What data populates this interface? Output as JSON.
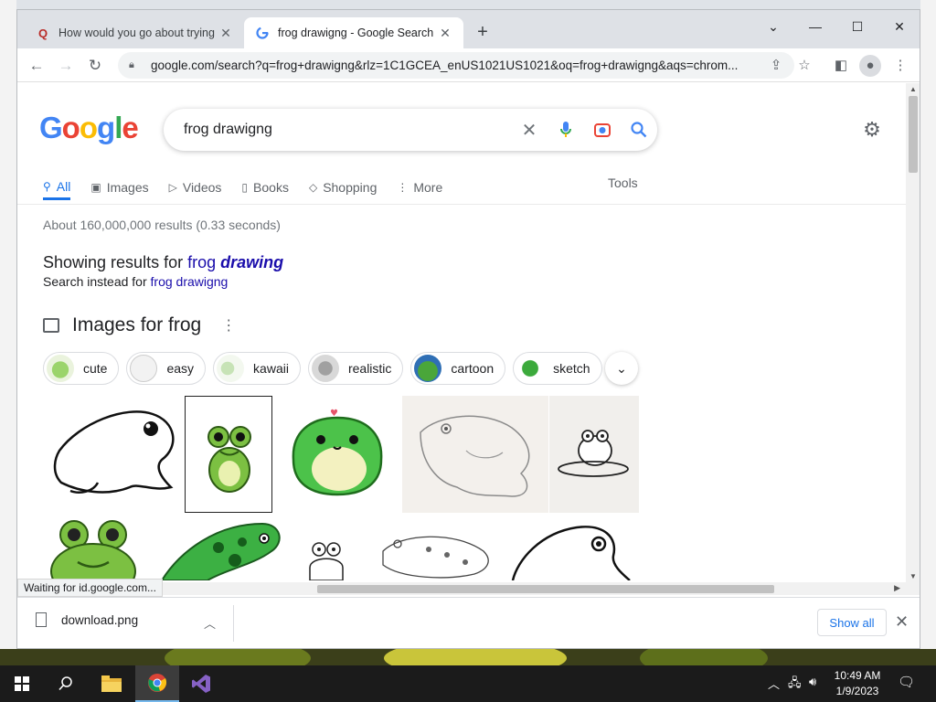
{
  "browser": {
    "tabs": [
      {
        "title": "How would you go about trying",
        "favicon": "quora-icon",
        "active": false
      },
      {
        "title": "frog drawigng - Google Search",
        "favicon": "google-icon",
        "active": true
      }
    ],
    "url": "google.com/search?q=frog+drawigng&rlz=1C1GCEA_enUS1021US1021&oq=frog+drawigng&aqs=chrom..."
  },
  "search": {
    "logo": "Google",
    "query": "frog drawigng"
  },
  "nav": {
    "tabs": [
      {
        "label": "All",
        "icon": "search-icon",
        "active": true
      },
      {
        "label": "Images",
        "icon": "image-icon"
      },
      {
        "label": "Videos",
        "icon": "video-icon"
      },
      {
        "label": "Books",
        "icon": "book-icon"
      },
      {
        "label": "Shopping",
        "icon": "tag-icon"
      },
      {
        "label": "More",
        "icon": "dots-icon"
      }
    ],
    "tools": "Tools"
  },
  "results": {
    "stats": "About 160,000,000 results (0.33 seconds)",
    "showing_prefix": "Showing results for",
    "corrected_plain": "frog",
    "corrected_bold": "drawing",
    "instead_prefix": "Search instead for",
    "instead_query": "frog drawigng"
  },
  "images": {
    "heading": "Images for frog",
    "chips": [
      "cute",
      "easy",
      "kawaii",
      "realistic",
      "cartoon",
      "sketch"
    ]
  },
  "status": "Waiting for id.google.com...",
  "downloads": {
    "file": "download.png",
    "show_all": "Show all"
  },
  "taskbar": {
    "time": "10:49 AM",
    "date": "1/9/2023"
  },
  "colors": {
    "accent": "#1a73e8",
    "link": "#1a0dab",
    "frog_green": "#5cb85c"
  }
}
